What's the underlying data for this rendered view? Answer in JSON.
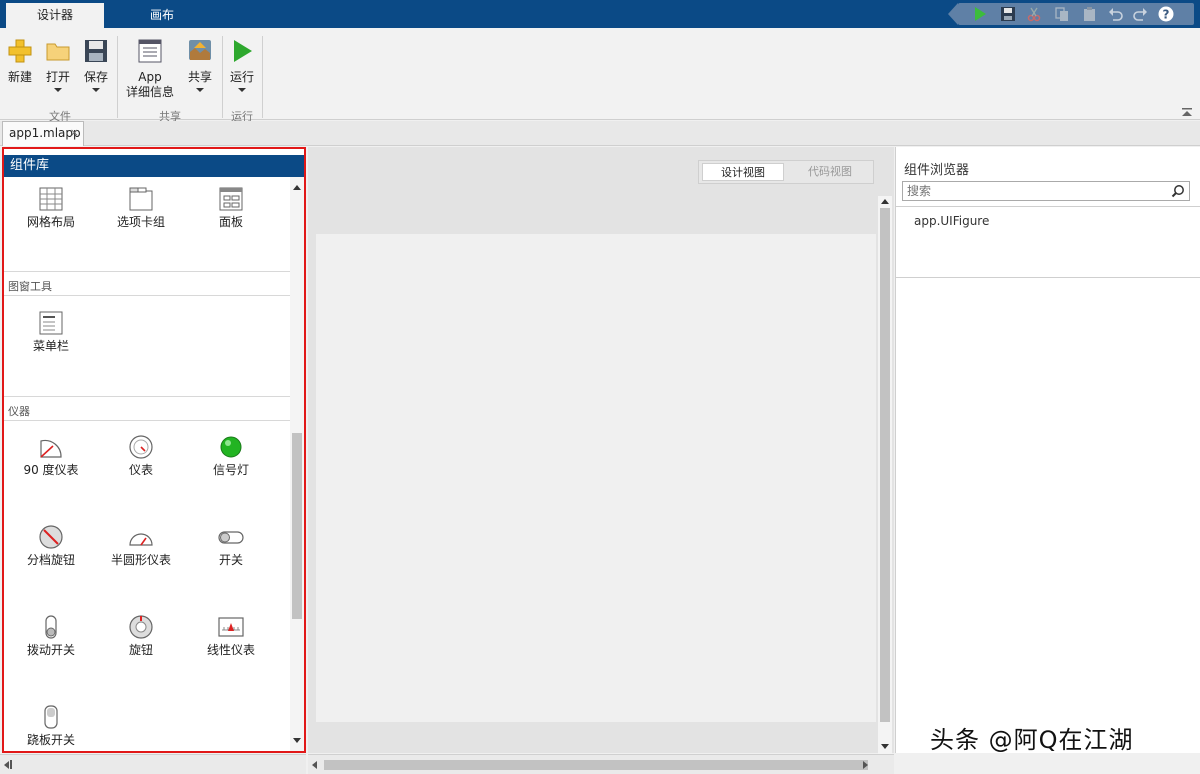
{
  "tabs": {
    "designer": "设计器",
    "canvas": "画布"
  },
  "ribbon": {
    "new": "新建",
    "open": "打开",
    "save": "保存",
    "app_line1": "App",
    "app_line2": "详细信息",
    "share": "共享",
    "run": "运行",
    "group_file": "文件",
    "group_share": "共享",
    "group_run": "运行"
  },
  "document": {
    "tab_name": "app1.mlapp",
    "close": "×"
  },
  "library": {
    "title": "组件库",
    "containers": [
      "网格布局",
      "选项卡组",
      "面板"
    ],
    "window_tools_title": "图窗工具",
    "window_tools": [
      "菜单栏"
    ],
    "instruments_title": "仪器",
    "instruments": [
      "90 度仪表",
      "仪表",
      "信号灯",
      "分档旋钮",
      "半圆形仪表",
      "开关",
      "拨动开关",
      "旋钮",
      "线性仪表",
      "跷板开关"
    ]
  },
  "view": {
    "design": "设计视图",
    "code": "代码视图"
  },
  "browser": {
    "title": "组件浏览器",
    "search_placeholder": "搜索",
    "root_item": "app.UIFigure"
  },
  "watermark": "头条 @阿Q在江湖",
  "colors": {
    "title_bar": "#0b4a86",
    "highlight": "#e11818",
    "run_green": "#2ea82e",
    "lamp_green": "#22b422"
  }
}
